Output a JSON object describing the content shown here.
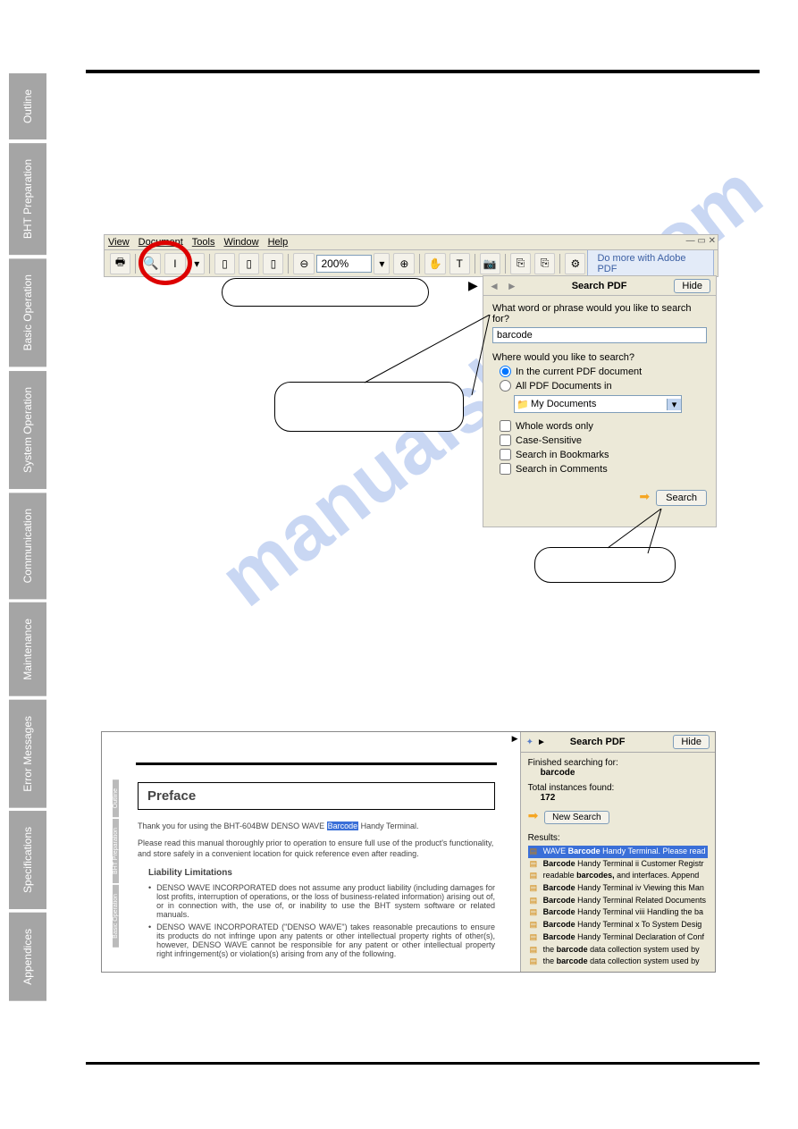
{
  "sidebar": {
    "tabs": [
      "Outline",
      "BHT Preparation",
      "Basic Operation",
      "System Operation",
      "Communication",
      "Maintenance",
      "Error Messages",
      "Specifications",
      "Appendices"
    ]
  },
  "watermark": "manualshive.com",
  "menubar": {
    "items": [
      "View",
      "Document",
      "Tools",
      "Window",
      "Help"
    ]
  },
  "toolbar": {
    "zoom_value": "200%",
    "adobe_label": "Do more with Adobe PDF"
  },
  "search_pane": {
    "title": "Search PDF",
    "hide_label": "Hide",
    "q_label": "What word or phrase would you like to search for?",
    "q_value": "barcode",
    "where_label": "Where would you like to search?",
    "radio_current": "In the current PDF document",
    "radio_all": "All PDF Documents in",
    "combo_value": "My Documents",
    "chk_whole": "Whole words only",
    "chk_case": "Case-Sensitive",
    "chk_bookmarks": "Search in Bookmarks",
    "chk_comments": "Search in Comments",
    "search_btn": "Search"
  },
  "doc": {
    "inner_tabs": [
      "Outline",
      "BHT Preparation",
      "Basic Operation"
    ],
    "preface_title": "Preface",
    "line1_a": "Thank you for using the BHT-604BW DENSO WAVE ",
    "line1_hl": "Barcode",
    "line1_b": " Handy Terminal.",
    "line2": "Please read this manual thoroughly prior to operation to ensure full use of the product's functionality, and store safely in a convenient location for quick reference even after reading.",
    "ll_title": "Liability Limitations",
    "bullet1": "DENSO WAVE INCORPORATED does not assume any product liability (including damages for lost profits, interruption of operations, or the loss of business-related information) arising out of, or in connection with, the use of, or inability to use the BHT system software or related manuals.",
    "bullet2": "DENSO WAVE INCORPORATED (\"DENSO WAVE\") takes reasonable precautions to ensure its products do not infringe upon any patents or other intellectual property rights of other(s), however, DENSO WAVE cannot be responsible for any patent or other intellectual property right infringement(s) or violation(s) arising from any of the following."
  },
  "results": {
    "title": "Search PDF",
    "hide_label": "Hide",
    "finished": "Finished searching for:",
    "term": "barcode",
    "total_label": "Total instances found:",
    "total_value": "172",
    "new_search": "New Search",
    "results_label": "Results:",
    "items": [
      {
        "pre": "WAVE",
        "bold": "Barcode",
        "post": "Handy Terminal. Please read",
        "sel": true
      },
      {
        "pre": "",
        "bold": "Barcode",
        "post": "Handy Terminal ii Customer Registr"
      },
      {
        "pre": "readable",
        "bold": "barcodes,",
        "post": "and interfaces. Append"
      },
      {
        "pre": "",
        "bold": "Barcode",
        "post": "Handy Terminal iv Viewing this Man"
      },
      {
        "pre": "",
        "bold": "Barcode",
        "post": "Handy Terminal Related Documents"
      },
      {
        "pre": "",
        "bold": "Barcode",
        "post": "Handy Terminal viii Handling the ba"
      },
      {
        "pre": "",
        "bold": "Barcode",
        "post": "Handy Terminal x To System Desig"
      },
      {
        "pre": "",
        "bold": "Barcode",
        "post": "Handy Terminal Declaration of Conf"
      },
      {
        "pre": "the",
        "bold": "barcode",
        "post": "data collection system used by"
      },
      {
        "pre": "the",
        "bold": "barcode",
        "post": "data collection system used by"
      }
    ]
  }
}
